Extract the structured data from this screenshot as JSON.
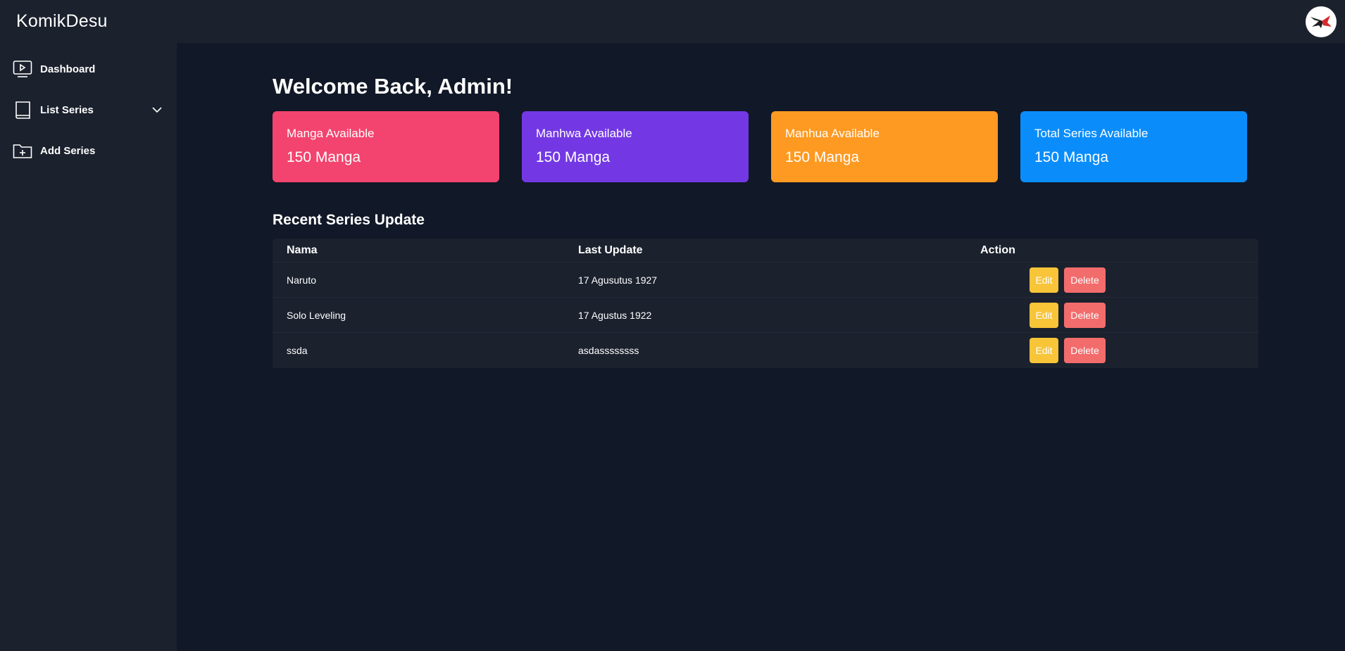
{
  "header": {
    "brand": "KomikDesu",
    "avatar_icon": "logo-avatar-icon"
  },
  "sidebar": {
    "items": [
      {
        "label": "Dashboard",
        "icon": "play-monitor-icon"
      },
      {
        "label": "List Series",
        "icon": "book-icon",
        "expandable": true
      },
      {
        "label": "Add Series",
        "icon": "folder-plus-icon"
      }
    ]
  },
  "main": {
    "welcome": "Welcome Back, Admin!",
    "cards": [
      {
        "title": "Manga Available",
        "value": "150 Manga",
        "color": "#f2446e"
      },
      {
        "title": "Manhwa Available",
        "value": "150 Manga",
        "color": "#7338e4"
      },
      {
        "title": "Manhua Available",
        "value": "150 Manga",
        "color": "#fe9a22"
      },
      {
        "title": "Total Series Available",
        "value": "150 Manga",
        "color": "#0a8dfb"
      }
    ],
    "section_title": "Recent Series Update",
    "table": {
      "headers": {
        "name": "Nama",
        "date": "Last Update",
        "action": "Action"
      },
      "rows": [
        {
          "name": "Naruto",
          "date": "17 Agusutus 1927",
          "edit": "Edit",
          "delete": "Delete"
        },
        {
          "name": "Solo Leveling",
          "date": "17 Agustus 1922",
          "edit": "Edit",
          "delete": "Delete"
        },
        {
          "name": "ssda",
          "date": "asdassssssss",
          "edit": "Edit",
          "delete": "Delete"
        }
      ]
    }
  },
  "colors": {
    "background": "#111827",
    "panel": "#1b212d",
    "edit_button": "#f8c438",
    "delete_button": "#f26c6c"
  }
}
